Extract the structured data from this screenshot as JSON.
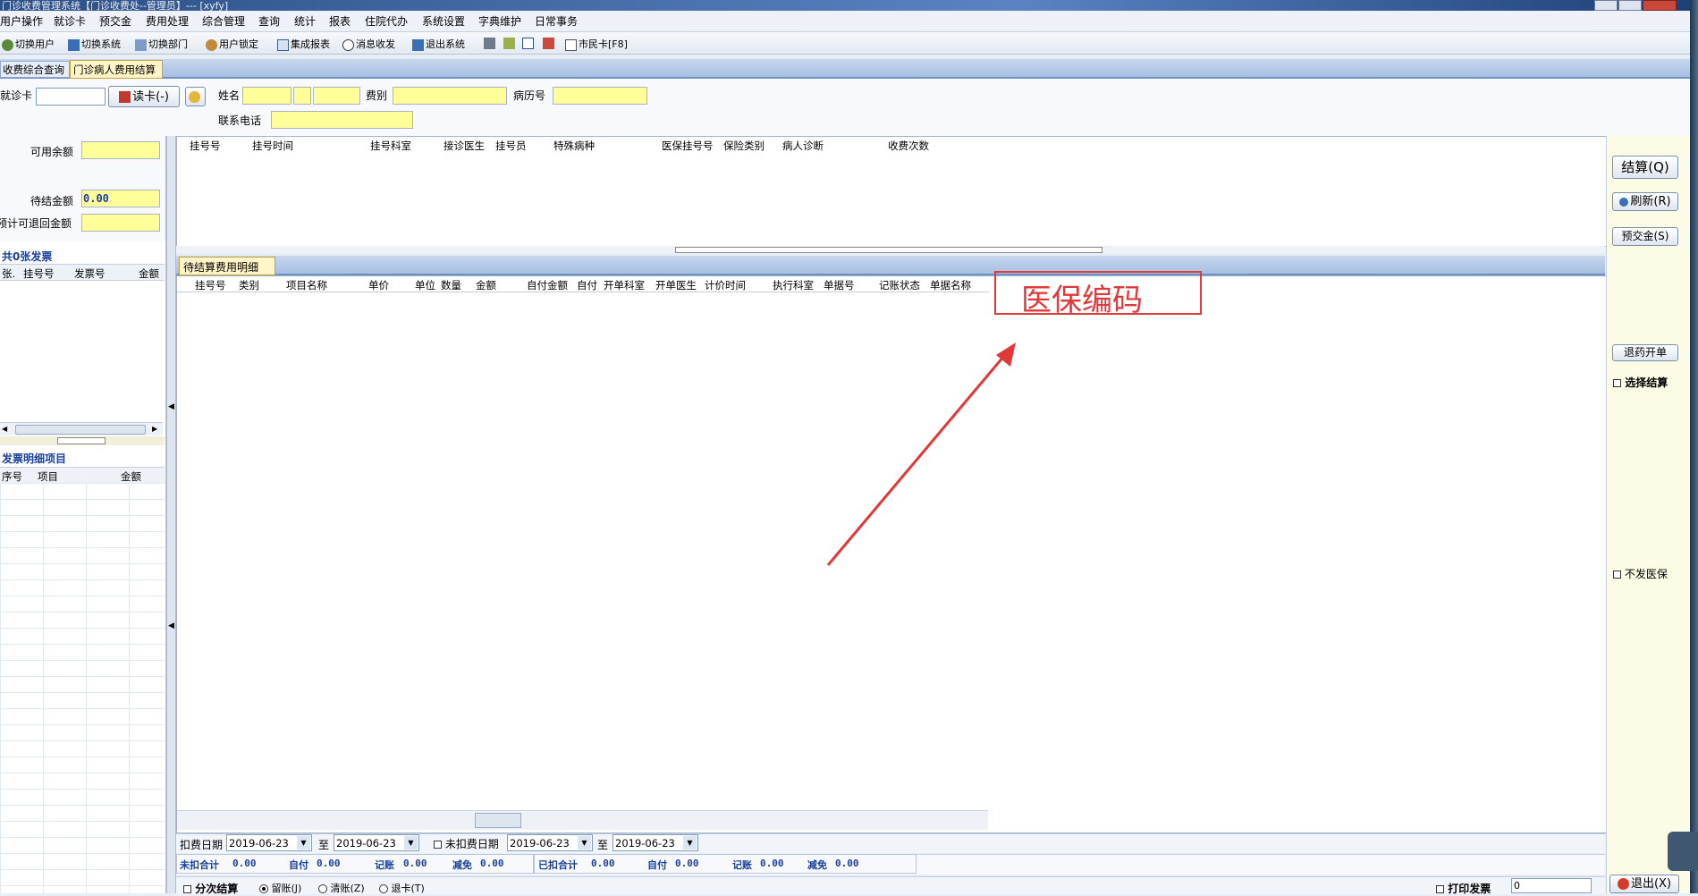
{
  "window": {
    "title": "门诊收费管理系统【门诊收费处--管理员】--- [xyfy]"
  },
  "menubar": [
    "用户操作",
    "就诊卡",
    "预交金",
    "费用处理",
    "综合管理",
    "查询",
    "统计",
    "报表",
    "住院代办",
    "系统设置",
    "字典维护",
    "日常事务"
  ],
  "toolbar": {
    "switch_user": "切换用户",
    "switch_system": "切换系统",
    "switch_dept": "切换部门",
    "user_lock": "用户锁定",
    "report": "集成报表",
    "message": "消息收发",
    "exit_system": "退出系统",
    "citizen_card": "市民卡[F8]"
  },
  "tabs": [
    "收费综合查询",
    "门诊病人费用结算"
  ],
  "patient": {
    "card_label": "就诊卡",
    "read_card": "读卡(-)",
    "name_label": "姓名",
    "fee_type_label": "费别",
    "record_no_label": "病历号",
    "phone_label": "联系电话"
  },
  "left": {
    "available_balance": "可用余额",
    "pending_amount": "待结金额",
    "pending_value": "0.00",
    "refundable": "预计可退回金额",
    "invoice_title": "共0张发票",
    "invoice_cols": [
      "张.",
      "挂号号",
      "发票号",
      "金额"
    ],
    "detail_title": "发票明细项目",
    "detail_cols": [
      "序号",
      "项目",
      "金额"
    ]
  },
  "register_cols": [
    "挂号号",
    "挂号时间",
    "挂号科室",
    "接诊医生",
    "挂号员",
    "特殊病种",
    "医保挂号号",
    "保险类别",
    "病人诊断",
    "收费次数"
  ],
  "detail_tab": "待结算费用明细",
  "detail_cols": [
    "挂号号",
    "类别",
    "项目名称",
    "单价",
    "单位",
    "数量",
    "金额",
    "自付金额",
    "自付",
    "开单科室",
    "开单医生",
    "计价时间",
    "执行科室",
    "单据号",
    "记账状态",
    "单据名称"
  ],
  "annotation": "医保编码",
  "dates": {
    "deduct_label": "扣费日期",
    "deduct_from": "2019-06-23",
    "to": "至",
    "deduct_to": "2019-06-23",
    "undeducted_label": "未扣费日期",
    "undeducted_from": "2019-06-23",
    "undeducted_to": "2019-06-23"
  },
  "totals": {
    "undeducted": "未扣合计",
    "undeducted_v": "0.00",
    "self_pay": "自付",
    "self_pay_v": "0.00",
    "charged": "记账",
    "charged_v": "0.00",
    "reduced": "减免",
    "reduced_v": "0.00",
    "deducted": "已扣合计",
    "deducted_v": "0.00",
    "self_pay2_v": "0.00",
    "charged2_v": "0.00",
    "reduced2_v": "0.00"
  },
  "bottom": {
    "split": "分次结算",
    "keep": "留账(J)",
    "clear": "清账(Z)",
    "refund": "退卡(T)",
    "print": "打印发票",
    "print_count": "0"
  },
  "right": {
    "settle": "结算(Q)",
    "refresh": "刷新(R)",
    "prepay": "预交金(S)",
    "return_drug": "退药开单",
    "select_settle": "选择结算",
    "no_insurance": "不发医保",
    "exit": "退出(X)"
  }
}
